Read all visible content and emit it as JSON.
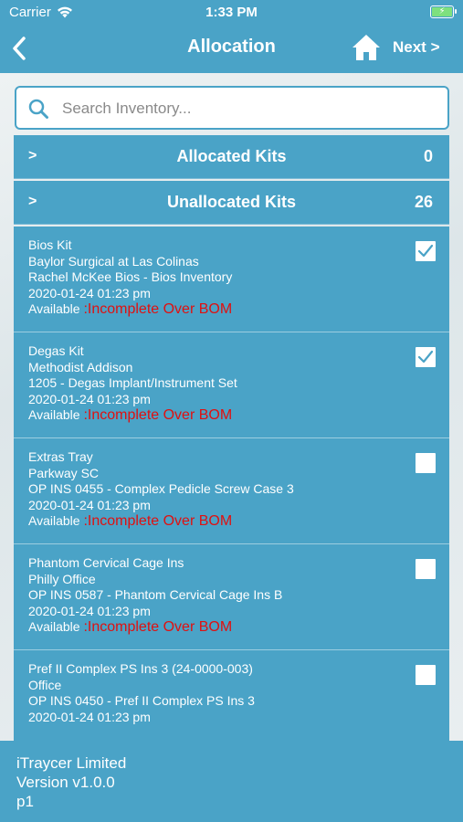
{
  "status_bar": {
    "carrier": "Carrier",
    "time": "1:33 PM"
  },
  "nav": {
    "title": "Allocation",
    "next_label": "Next >"
  },
  "search": {
    "placeholder": "Search Inventory..."
  },
  "sections": {
    "allocated": {
      "chevron": ">",
      "label": "Allocated Kits",
      "count": "0"
    },
    "unallocated": {
      "chevron": ">",
      "label": "Unallocated Kits",
      "count": "26"
    }
  },
  "kits": [
    {
      "name": "Bios Kit",
      "location": "Baylor Surgical at Las Colinas",
      "set": "Rachel McKee Bios - Bios Inventory",
      "date": "2020-01-24 01:23 pm",
      "availability": "Available",
      "status": ":Incomplete Over BOM",
      "checked": true
    },
    {
      "name": "Degas Kit",
      "location": "Methodist Addison",
      "set": "1205 - Degas Implant/Instrument Set",
      "date": "2020-01-24 01:23 pm",
      "availability": "Available",
      "status": ":Incomplete Over BOM",
      "checked": true
    },
    {
      "name": "Extras Tray",
      "location": "Parkway SC",
      "set": "OP INS 0455 - Complex Pedicle Screw Case 3",
      "date": "2020-01-24 01:23 pm",
      "availability": "Available",
      "status": ":Incomplete Over BOM",
      "checked": false
    },
    {
      "name": "Phantom Cervical Cage Ins",
      "location": "Philly Office",
      "set": "OP INS 0587 - Phantom Cervical Cage Ins B",
      "date": "2020-01-24 01:23 pm",
      "availability": "Available",
      "status": ":Incomplete Over BOM",
      "checked": false
    },
    {
      "name": "Pref II Complex PS Ins 3 (24-0000-003)",
      "location": "Office",
      "set": "OP INS 0450 - Pref II Complex PS Ins 3",
      "date": "2020-01-24 01:23 pm",
      "availability": "",
      "status": "",
      "checked": false
    }
  ],
  "footer": {
    "company": "iTraycer Limited",
    "version": "Version v1.0.0",
    "user": "p1"
  },
  "colors": {
    "primary": "#4aa3c7",
    "status_red": "#e01010",
    "checkbox": "#4aa3c7"
  }
}
